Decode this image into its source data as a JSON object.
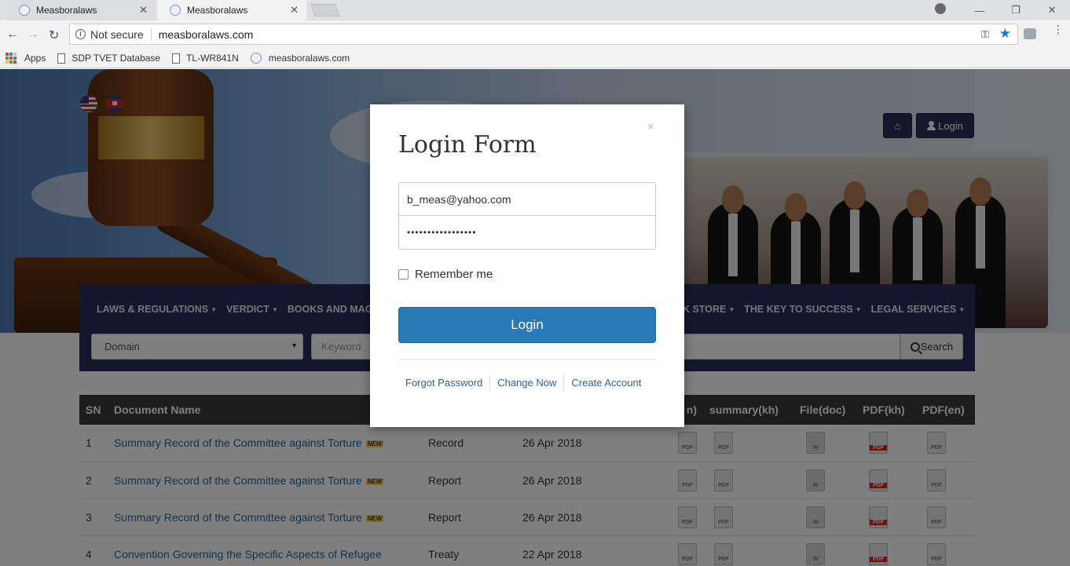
{
  "browser": {
    "tabs": [
      {
        "title": "Measboralaws"
      },
      {
        "title": "Measboralaws"
      }
    ],
    "security_label": "Not secure",
    "url": "measboralaws.com",
    "bookmarks": [
      {
        "label": "Apps"
      },
      {
        "label": "SDP TVET Database"
      },
      {
        "label": "TL-WR841N"
      },
      {
        "label": "measboralaws.com"
      }
    ]
  },
  "header": {
    "login_label": "Login"
  },
  "nav": {
    "items_left": [
      {
        "label": "LAWS & REGULATIONS"
      },
      {
        "label": "VERDICT"
      },
      {
        "label": "BOOKS AND MAGA"
      }
    ],
    "items_right": [
      {
        "label": "K STORE"
      },
      {
        "label": "THE KEY TO SUCCESS"
      },
      {
        "label": "LEGAL SERVICES"
      }
    ],
    "domain_placeholder": "Domain",
    "keyword_placeholder": "Keyword",
    "search_label": "Search"
  },
  "table": {
    "columns": [
      "SN",
      "Document Name",
      "",
      "",
      "n)",
      "summary(kh)",
      "File(doc)",
      "PDF(kh)",
      "PDF(en)"
    ],
    "new_badge": "NEW",
    "rows": [
      {
        "sn": "1",
        "name": "Summary Record of the Committee against Torture",
        "new": true,
        "type": "Record",
        "date": "26 Apr 2018"
      },
      {
        "sn": "2",
        "name": "Summary Record of the Committee against Torture",
        "new": true,
        "type": "Report",
        "date": "26 Apr 2018"
      },
      {
        "sn": "3",
        "name": "Summary Record of the Committee against Torture",
        "new": true,
        "type": "Report",
        "date": "26 Apr 2018"
      },
      {
        "sn": "4",
        "name": "Convention Governing the Specific Aspects of Refugee",
        "new": false,
        "type": "Treaty",
        "date": "22 Apr 2018"
      }
    ],
    "icon_labels": {
      "pdf": "PDF",
      "doc": "W"
    }
  },
  "modal": {
    "close": "×",
    "title": "Login Form",
    "email_value": "b_meas@yahoo.com",
    "password_value": "•••••••••••••••••",
    "remember_label": "Remember me",
    "submit_label": "Login",
    "links": [
      {
        "label": "Forgot Password"
      },
      {
        "label": "Change Now"
      },
      {
        "label": "Create Account"
      }
    ]
  },
  "colors": {
    "navbar": "#2b2a5b",
    "primary_button": "#2a7ab8",
    "link": "#2a6496",
    "table_header": "#3a3a3a"
  }
}
